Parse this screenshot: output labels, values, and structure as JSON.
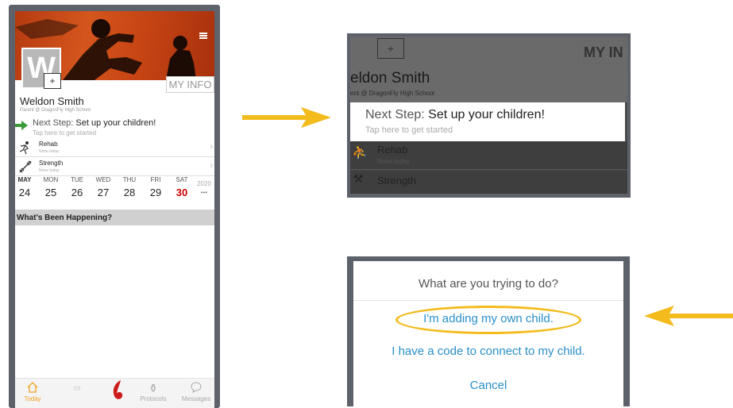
{
  "phone": {
    "profile": {
      "avatar_letter": "W",
      "name": "Weldon Smith",
      "subtitle": "Parent @ DragonFly High School",
      "my_info_label": "MY INFO"
    },
    "next_step": {
      "label": "Next Step:",
      "text": "Set up your children!",
      "hint": "Tap here to get started"
    },
    "rows": [
      {
        "title": "Rehab",
        "subtitle": "None today"
      },
      {
        "title": "Strength",
        "subtitle": "None today"
      }
    ],
    "calendar": {
      "days": [
        {
          "dow": "MAY",
          "num": "24"
        },
        {
          "dow": "MON",
          "num": "25"
        },
        {
          "dow": "TUE",
          "num": "26"
        },
        {
          "dow": "WED",
          "num": "27"
        },
        {
          "dow": "THU",
          "num": "28"
        },
        {
          "dow": "FRI",
          "num": "29"
        },
        {
          "dow": "SAT",
          "num": "30"
        }
      ],
      "year": "2020",
      "more": "•••"
    },
    "section_header": "What's Been Happening?",
    "tabs": [
      {
        "label": "Today",
        "icon": "home-icon"
      },
      {
        "label": "",
        "icon": "dragonfly-logo-icon"
      },
      {
        "label": "Protocols",
        "icon": "protocols-icon"
      },
      {
        "label": "Messages",
        "icon": "chat-icon"
      }
    ],
    "colors": {
      "today_accent": "#f0a020",
      "sat_highlight": "#cc0000",
      "next_arrow": "#3a9a3a"
    }
  },
  "zoom": {
    "name": "eldon Smith",
    "subtitle": "ent @ DragonFly High School",
    "my_info_label": "MY IN",
    "next_step_label": "Next Step:",
    "next_step_text": "Set up your children!",
    "hint": "Tap here to get started",
    "rows": [
      {
        "title": "Rehab",
        "subtitle": "None today"
      },
      {
        "title": "Strength"
      }
    ]
  },
  "dialog": {
    "question": "What are you trying to do?",
    "option_own": "I'm adding my own child.",
    "option_code": "I have a code to connect to my child.",
    "cancel": "Cancel"
  },
  "annotation_colors": {
    "arrow": "#f3bb1c"
  }
}
